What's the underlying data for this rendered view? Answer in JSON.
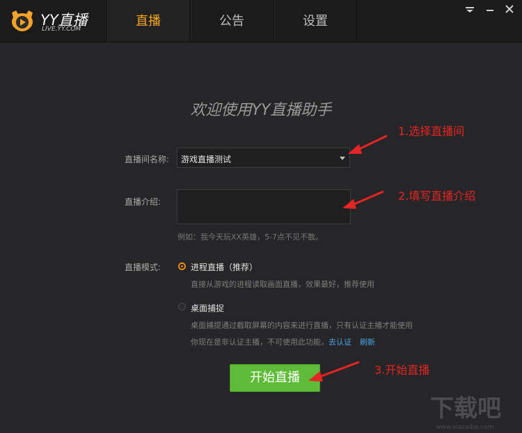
{
  "app": {
    "logo_title": "YY直播",
    "logo_subtitle": "LIVE.YY.COM"
  },
  "tabs": [
    {
      "label": "直播",
      "active": true
    },
    {
      "label": "公告",
      "active": false
    },
    {
      "label": "设置",
      "active": false
    }
  ],
  "heading": "欢迎使用YY直播助手",
  "room": {
    "label": "直播间名称:",
    "value": "游戏直播测试"
  },
  "intro": {
    "label": "直播介绍:",
    "value": "",
    "hint": "例如：我今天玩XX英雄，5-7点不见不散。"
  },
  "mode": {
    "label": "直播模式:",
    "options": [
      {
        "title": "进程直播（推荐）",
        "desc": "直接从游戏的进程读取画面直播，效果最好，推荐使用",
        "selected": true
      },
      {
        "title": "桌面捕捉",
        "desc": "桌面捕提通过截取屏幕的内容来进行直播，只有认证主播才能使用",
        "note": "你现在是非认证主播，不可使用此功能，",
        "link_certify": "去认证",
        "link_refresh": "刷新",
        "selected": false
      }
    ]
  },
  "start_button": "开始直播",
  "annotations": {
    "a1": "1.选择直播间",
    "a2": "2.填写直播介绍",
    "a3": "3.开始直播"
  },
  "watermark": {
    "text": "下载吧",
    "url_text": "www.xiazaiba.com"
  },
  "colors": {
    "accent": "#f5a623",
    "button_green": "#5dbb37",
    "annotation_red": "#e52424",
    "link_blue": "#4aa3e8"
  }
}
